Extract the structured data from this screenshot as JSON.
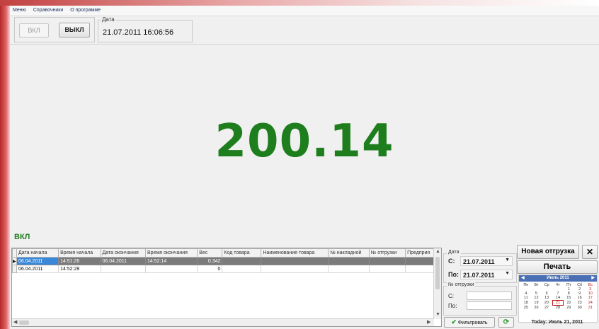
{
  "menu": [
    "Меню",
    "Справочники",
    "О программе"
  ],
  "controls": {
    "on_label": "ВКЛ",
    "off_label": "ВЫКЛ"
  },
  "date_panel": {
    "label": "Дата",
    "value": "21.07.2011   16:06:56"
  },
  "display": {
    "weight": "200.14",
    "status": "ВКЛ"
  },
  "table": {
    "columns": [
      "Дата начала",
      "Время начала",
      "Дата окончания",
      "Время окончания",
      "Вес",
      "Код товара",
      "Наименование товара",
      "№ накладной",
      "№ отгрузки",
      "Предприя"
    ],
    "rows": [
      [
        "06.04.2011",
        "14:51:26",
        "06.04.2011",
        "14:52:14",
        "0.342",
        "",
        "",
        "",
        "",
        ""
      ],
      [
        "06.04.2011",
        "14:52:28",
        "",
        "",
        "0",
        "",
        "",
        "",
        "",
        ""
      ]
    ],
    "selected_row": 0
  },
  "filter": {
    "date_group": "Дата",
    "from_label": "С:",
    "from_value": "21.07.2011",
    "to_label": "По:",
    "to_value": "21.07.2011",
    "shipment_group": "№ отгрузки",
    "ship_from_label": "С:",
    "ship_to_label": "По:",
    "filter_button": "Фильтровать"
  },
  "actions": {
    "new_shipment": "Новая отгрузка",
    "close": "✕",
    "print": "Печать"
  },
  "calendar": {
    "month": "Июль 2011",
    "weekdays": [
      "Пн",
      "Вт",
      "Ср",
      "Чт",
      "Пт",
      "Сб",
      "Вс"
    ],
    "weeks": [
      [
        "",
        "",
        "",
        "",
        "1",
        "2",
        "3"
      ],
      [
        "4",
        "5",
        "6",
        "7",
        "8",
        "9",
        "10"
      ],
      [
        "11",
        "12",
        "13",
        "14",
        "15",
        "16",
        "17"
      ],
      [
        "18",
        "19",
        "20",
        "21",
        "22",
        "23",
        "24"
      ],
      [
        "25",
        "26",
        "27",
        "28",
        "29",
        "30",
        "31"
      ]
    ],
    "today_text": "Today: Июль 21, 2011"
  },
  "colors": {
    "weight": "#1e7e1e",
    "selection": "#3a88d8",
    "calendar_header": "#4a6fb4"
  }
}
